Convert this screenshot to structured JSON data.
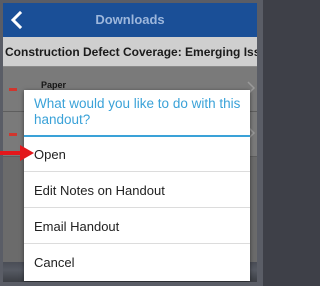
{
  "appbar": {
    "title": "Downloads",
    "back_icon": "chevron-left-icon",
    "color": "#1a4f97"
  },
  "subheader": {
    "title": "Construction Defect Coverage: Emerging Iss..."
  },
  "list": {
    "items": [
      {
        "label": "Paper",
        "marker_color": "#d0362e"
      },
      {
        "label": "",
        "marker_color": "#d0362e"
      }
    ]
  },
  "dialog": {
    "title": "What would you like to do with this handout?",
    "accent_color": "#3aa2d8",
    "options": [
      {
        "label": "Open"
      },
      {
        "label": "Edit Notes on Handout"
      },
      {
        "label": "Email Handout"
      },
      {
        "label": "Cancel"
      }
    ]
  },
  "annotation": {
    "pointer_icon": "red-arrow-icon",
    "color": "#e3171b"
  }
}
